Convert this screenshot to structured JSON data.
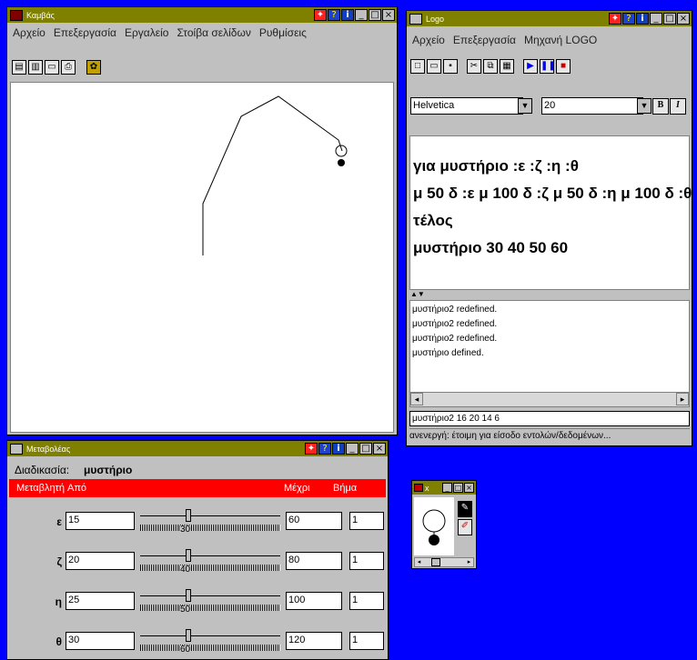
{
  "canvas_window": {
    "title": "Καμβάς",
    "menu": [
      "Αρχείο",
      "Επεξεργασία",
      "Εργαλείο",
      "Στοίβα σελίδων",
      "Ρυθμίσεις"
    ]
  },
  "logo_window": {
    "title": "Logo",
    "menu": [
      "Αρχείο",
      "Επεξεργασία",
      "Μηχανή LOGO"
    ],
    "font_name": "Helvetica",
    "font_size": "20",
    "bold_label": "B",
    "italic_label": "I",
    "editor_lines": [
      "για μυστήριο :ε :ζ :η :θ",
      "μ 50 δ :ε μ 100 δ :ζ μ 50 δ :η μ 100 δ :θ",
      "τέλος",
      "μυστήριο 30 40 50 60"
    ],
    "splitter": "▲▼",
    "output_lines": [
      "μυστήριο2 redefined.",
      "μυστήριο2 redefined.",
      "μυστήριο2 redefined.",
      "μυστήριο defined."
    ],
    "command_line": "μυστήριο2 16 20 14 6",
    "status": "ανενεργή: έτοιμη για είσοδο εντολών/δεδομένων..."
  },
  "variables_window": {
    "title": "Μεταβολέας",
    "procedure_label": "Διαδικασία:",
    "procedure_name": "μυστήριο",
    "col_variable": "Μεταβλητή",
    "col_from": "Από",
    "col_to": "Μέχρι",
    "col_step": "Βήμα",
    "params": [
      {
        "name": "ε",
        "from": "15",
        "value": "30",
        "to": "60",
        "step": "1"
      },
      {
        "name": "ζ",
        "from": "20",
        "value": "40",
        "to": "80",
        "step": "1"
      },
      {
        "name": "η",
        "from": "25",
        "value": "50",
        "to": "100",
        "step": "1"
      },
      {
        "name": "θ",
        "from": "30",
        "value": "60",
        "to": "120",
        "step": "1"
      }
    ],
    "header_color": "#ff0000"
  },
  "turtle_window": {
    "title": "x"
  },
  "colors": {
    "desktop": "#0000ff",
    "titlebar": "#808000",
    "window": "#c0c0c0"
  }
}
